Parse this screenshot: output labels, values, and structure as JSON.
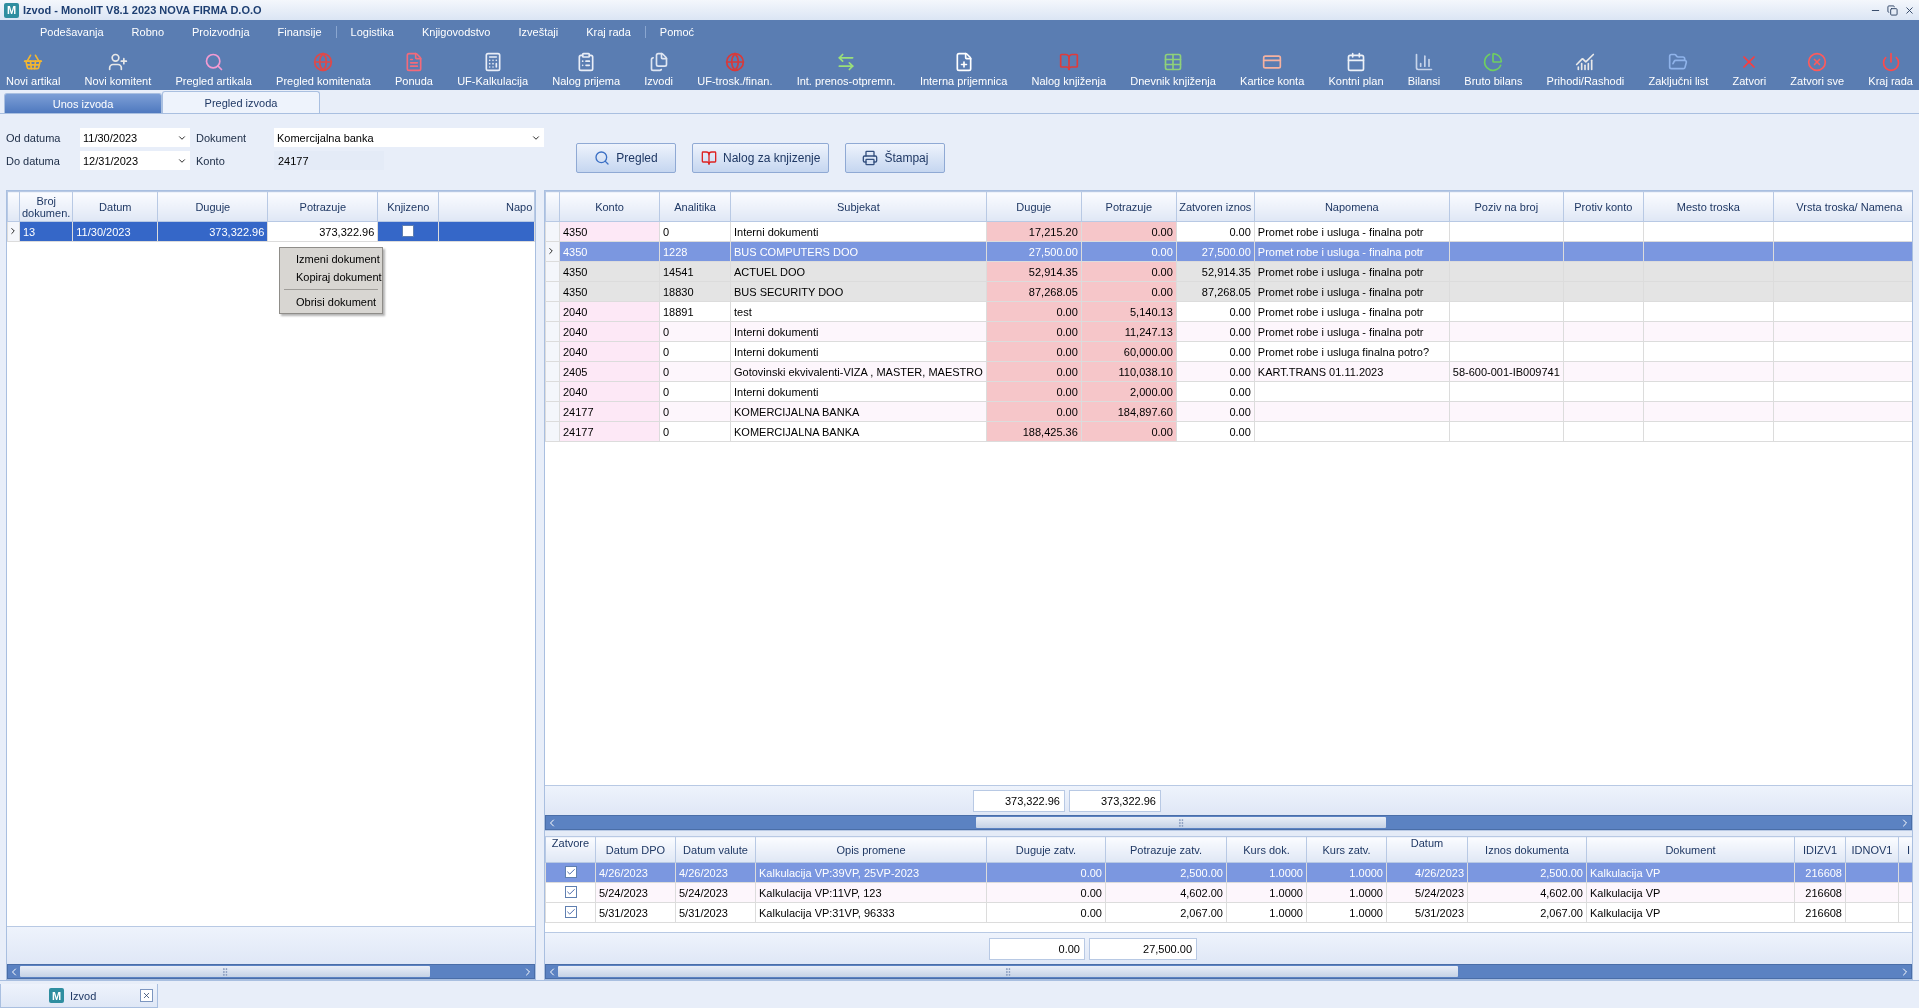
{
  "window": {
    "logo": "M",
    "title": "Izvod - MonolIT V8.1 2023 NOVA FIRMA D.O.O"
  },
  "menu": [
    "Podešavanja",
    "Robno",
    "Proizvodnja",
    "Finansije",
    "Logistika",
    "Knjigovodstvo",
    "Izveštaji",
    "Kraj rada",
    "Pomoć"
  ],
  "toolbar": [
    "Novi artikal",
    "Novi komitent",
    "Pregled artikala",
    "Pregled komitenata",
    "Ponuda",
    "UF-Kalkulacija",
    "Nalog prijema",
    "Izvodi",
    "UF-trosk./finan.",
    "Int. prenos-otpremn.",
    "Interna prijemnica",
    "Nalog knjiženja",
    "Dnevnik knjiženja",
    "Kartice konta",
    "Kontni plan",
    "Bilansi",
    "Bruto bilans",
    "Prihodi/Rashodi",
    "Zaključni list",
    "Zatvori",
    "Zatvori sve",
    "Kraj rada"
  ],
  "tabs": [
    {
      "label": "Unos izvoda",
      "selected": false
    },
    {
      "label": "Pregled izvoda",
      "selected": true
    }
  ],
  "filters": {
    "od_datuma": {
      "label": "Od datuma",
      "value": "11/30/2023"
    },
    "do_datuma": {
      "label": "Do datuma",
      "value": "12/31/2023"
    },
    "dokument": {
      "label": "Dokument",
      "value": "Komercijalna banka"
    },
    "konto": {
      "label": "Konto",
      "value": "24177"
    }
  },
  "actions": [
    "Pregled",
    "Nalog za knjizenje",
    "Štampaj"
  ],
  "documents": {
    "columns": [
      "Broj dokumen.",
      "Datum",
      "Duguje",
      "Potrazuje",
      "Knjizeno",
      "Napo"
    ],
    "rows": [
      {
        "selected": true,
        "cells": [
          "13",
          "11/30/2023",
          "373,322.96",
          "373,322.96"
        ],
        "knjizeno": false
      }
    ]
  },
  "context_menu": [
    [
      "Izmeni dokument",
      "Kopiraj dokument"
    ],
    [
      "Obrisi dokument"
    ]
  ],
  "entries": {
    "columns": [
      "Konto",
      "Analitika",
      "Subjekat",
      "Duguje",
      "Potrazuje",
      "Zatvoren iznos",
      "Napomena",
      "Poziv na broj",
      "Protiv konto",
      "Mesto troska",
      "Vrsta troska/ Namena"
    ],
    "rows": [
      {
        "selected": false,
        "shaded": false,
        "cells": [
          "4350",
          "0",
          "Interni dokumenti",
          "17,215.20",
          "0.00",
          "0.00",
          "Promet robe i usluga - finalna potr"
        ]
      },
      {
        "selected": true,
        "shaded": false,
        "cells": [
          "4350",
          "1228",
          "BUS COMPUTERS DOO",
          "27,500.00",
          "0.00",
          "27,500.00",
          "Promet robe i usluga - finalna potr"
        ]
      },
      {
        "selected": false,
        "shaded": true,
        "cells": [
          "4350",
          "14541",
          "ACTUEL DOO",
          "52,914.35",
          "0.00",
          "52,914.35",
          "Promet robe i usluga - finalna potr"
        ]
      },
      {
        "selected": false,
        "shaded": true,
        "cells": [
          "4350",
          "18830",
          "BUS SECURITY DOO",
          "87,268.05",
          "0.00",
          "87,268.05",
          "Promet robe i usluga - finalna potr"
        ]
      },
      {
        "selected": false,
        "shaded": false,
        "cells": [
          "2040",
          "18891",
          "test",
          "0.00",
          "5,140.13",
          "0.00",
          "Promet robe i usluga - finalna potr"
        ]
      },
      {
        "selected": false,
        "shaded": false,
        "cells": [
          "2040",
          "0",
          "Interni dokumenti",
          "0.00",
          "11,247.13",
          "0.00",
          "Promet robe i usluga - finalna potr"
        ]
      },
      {
        "selected": false,
        "shaded": false,
        "cells": [
          "2040",
          "0",
          "Interni dokumenti",
          "0.00",
          "60,000.00",
          "0.00",
          "Promet robe i usluga finalna potro?"
        ]
      },
      {
        "selected": false,
        "shaded": false,
        "cells": [
          "2405",
          "0",
          "Gotovinski ekvivalenti-VIZA , MASTER, MAESTRO",
          "0.00",
          "110,038.10",
          "0.00",
          "KART.TRANS 01.11.2023",
          "58-600-001-IB009741"
        ]
      },
      {
        "selected": false,
        "shaded": false,
        "cells": [
          "2040",
          "0",
          "Interni dokumenti",
          "0.00",
          "2,000.00",
          "0.00"
        ]
      },
      {
        "selected": false,
        "shaded": false,
        "cells": [
          "24177",
          "0",
          "KOMERCIJALNA BANKA",
          "0.00",
          "184,897.60",
          "0.00"
        ]
      },
      {
        "selected": false,
        "shaded": false,
        "cells": [
          "24177",
          "0",
          "KOMERCIJALNA BANKA",
          "188,425.36",
          "0.00",
          "0.00"
        ]
      }
    ],
    "totals": [
      "373,322.96",
      "373,322.96"
    ]
  },
  "closures": {
    "columns": [
      "Zatvore",
      "Datum DPO",
      "Datum valute",
      "Opis promene",
      "Duguje zatv.",
      "Potrazuje zatv.",
      "Kurs dok.",
      "Kurs zatv.",
      "Datum",
      "Iznos dokumenta",
      "Dokument",
      "IDIZV1",
      "IDNOV1",
      "I"
    ],
    "rows": [
      {
        "selected": true,
        "checked": true,
        "cells": [
          "",
          "4/26/2023",
          "4/26/2023",
          "Kalkulacija VP:39VP, 25VP-2023",
          "0.00",
          "2,500.00",
          "1.0000",
          "1.0000",
          "4/26/2023",
          "2,500.00",
          "Kalkulacija VP",
          "216608"
        ]
      },
      {
        "selected": false,
        "checked": true,
        "cells": [
          "",
          "5/24/2023",
          "5/24/2023",
          "Kalkulacija VP:11VP, 123",
          "0.00",
          "4,602.00",
          "1.0000",
          "1.0000",
          "5/24/2023",
          "4,602.00",
          "Kalkulacija VP",
          "216608"
        ]
      },
      {
        "selected": false,
        "checked": true,
        "cells": [
          "",
          "5/31/2023",
          "5/31/2023",
          "Kalkulacija VP:31VP, 96333",
          "0.00",
          "2,067.00",
          "1.0000",
          "1.0000",
          "5/31/2023",
          "2,067.00",
          "Kalkulacija VP",
          "216608"
        ]
      }
    ],
    "totals": [
      "0.00",
      "27,500.00"
    ]
  },
  "doc_tabs": [
    {
      "logo": "M",
      "label": "Izvod"
    }
  ]
}
